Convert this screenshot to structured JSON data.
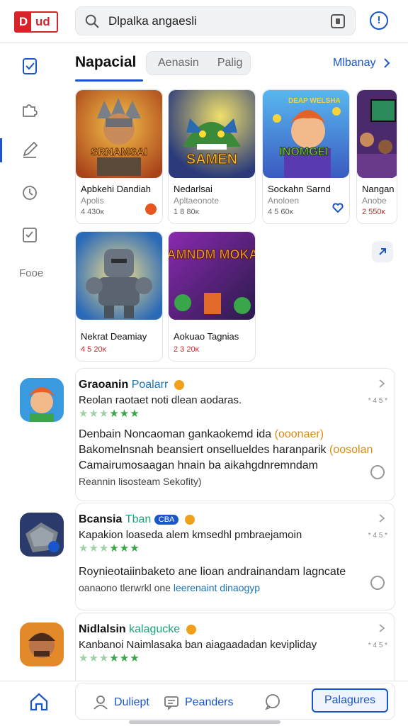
{
  "header": {
    "logo_text": "ud",
    "logo_mark": "D",
    "search_value": "Dlpalka angaesli",
    "info_label": "!"
  },
  "sidebar": {
    "label": "Fooe",
    "icons": [
      "clipboard-icon",
      "puzzle-icon",
      "pencil-icon",
      "timer-icon",
      "checklist-icon"
    ]
  },
  "tabs": {
    "active": "Napacial",
    "segment": [
      "Aenasin",
      "Palig"
    ],
    "more_link": "Mlbanay"
  },
  "games": [
    {
      "title": "Apbkehi Dandiah",
      "subtitle": "Apolis",
      "count": "4 430ĸ",
      "badge": "orange-dot"
    },
    {
      "title": "Nedarlsai",
      "subtitle": "Apltaeonote",
      "count": "1 8 80ĸ",
      "badge": ""
    },
    {
      "title": "Sockahn Sarnd",
      "subtitle": "Anoloen",
      "count": "4 5 60ĸ",
      "badge": "heart-icon"
    },
    {
      "title": "Nangan",
      "subtitle": "Anobe",
      "count": "2 550ĸ",
      "badge": ""
    },
    {
      "title": "Nekrat Deamiay",
      "subtitle": "",
      "count": "4 5 20ĸ",
      "badge": ""
    },
    {
      "title": "Aokuao Tagnias",
      "subtitle": "",
      "count": "2 3 20ĸ",
      "badge": ""
    }
  ],
  "art_text": {
    "g1": "SRNAMSAI",
    "g2": "SAMEN",
    "g3": "INOMGEI",
    "g3_top": "DEAP WELSHA",
    "g6": "MAMNDM MOKAN"
  },
  "items": [
    {
      "name": "Graoanin",
      "highlight": "Poalarr",
      "sub": "Reolan raotaet noti dlean aodaras.",
      "meta": "* 4 5 *",
      "desc1": "Denbain Noncaoman gankaokemd ida",
      "desc1_accent": "(ooonaer)",
      "desc2": "Bakomelnsnah beansiert onsellueldes haranparik",
      "desc2_accent": "(oosolan",
      "desc3": "Camairumosaagan hnain ba aikahgdnremndam",
      "desc4": "Reannin lisosteam Sekofity)"
    },
    {
      "name": "Bcansia",
      "highlight": "Tban",
      "pill": "CBA",
      "sub": "Kapakion loaseda alem kmsedhl pmbraejamoin",
      "meta": "* 4 5 *",
      "desc1": "Roynieotaiinbaketo ane lioan andrainandam lagncate",
      "desc2": "oanaono tlerwrkl one",
      "desc2_accent": "leerenaint dinaogyp"
    },
    {
      "name": "Nidlalsin",
      "highlight": "kalagucke",
      "sub": "Kanbanoi Naimlasaka ban aiagaadadan kevipliday",
      "meta": "* 4 5 *"
    }
  ],
  "bottom_nav": {
    "profile_label": "Duliept",
    "reviews_label": "Peanders",
    "primary_label": "Palagures"
  },
  "colors": {
    "accent": "#1a56c9",
    "brand": "#d8232a",
    "rating": "#3aa64a"
  }
}
